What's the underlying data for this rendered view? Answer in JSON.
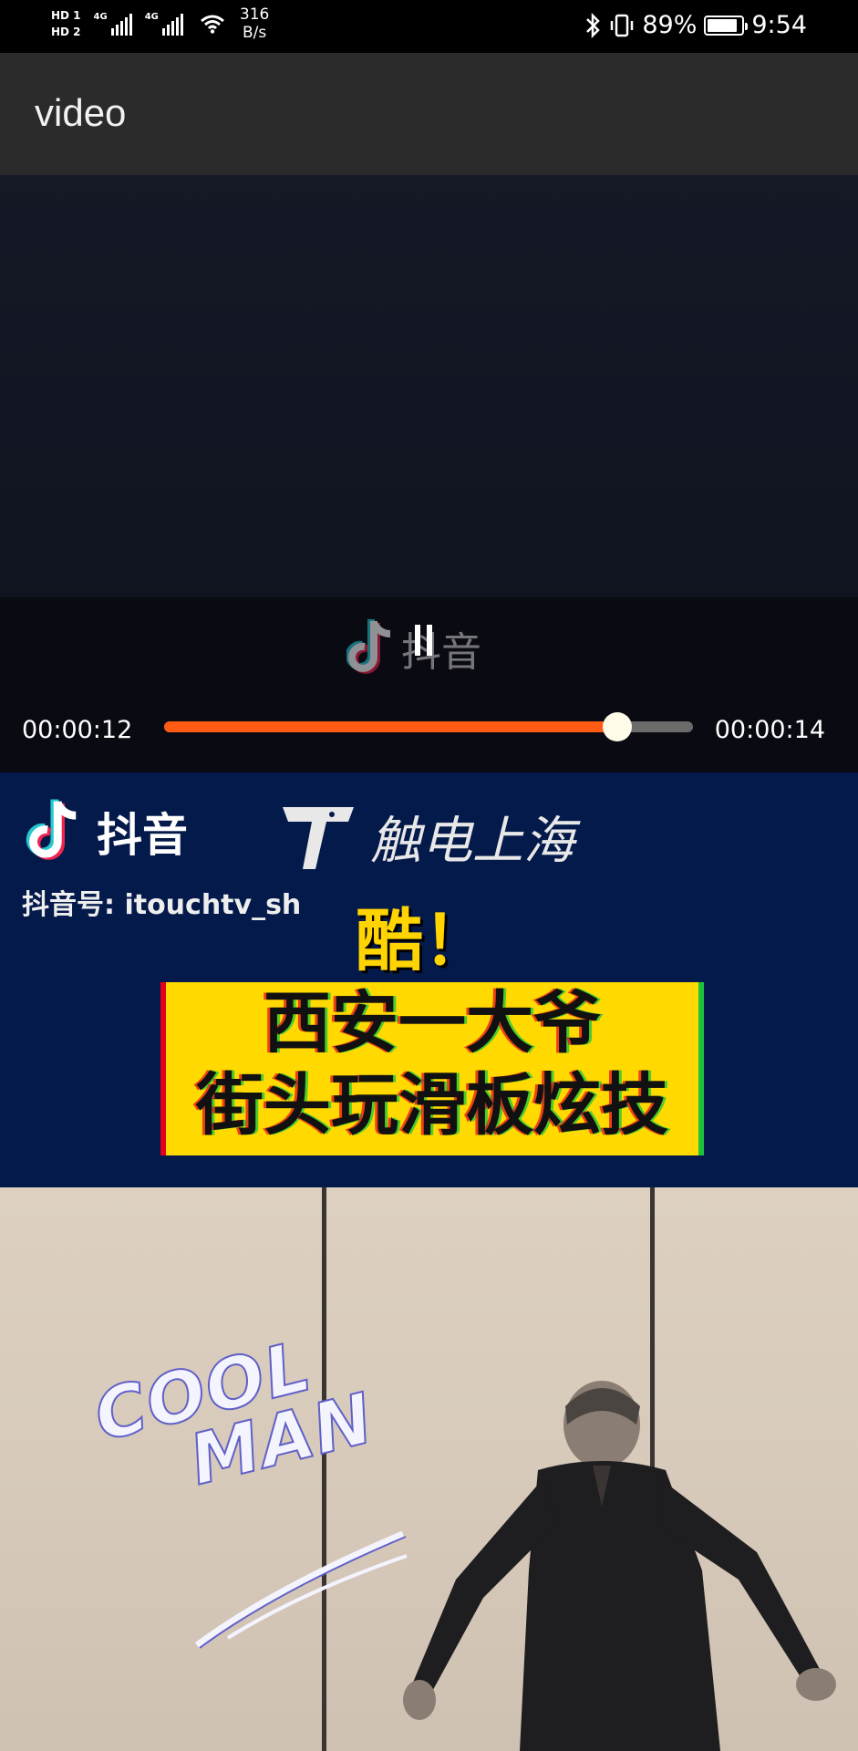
{
  "status_bar": {
    "hd1": "HD 1",
    "hd2": "HD 2",
    "net1": "4G",
    "net2": "4G",
    "speed_value": "316",
    "speed_unit": "B/s",
    "battery": "89%",
    "time": "9:54"
  },
  "app_bar": {
    "title": "video"
  },
  "player": {
    "watermark": "抖音",
    "current_time": "00:00:12",
    "total_time": "00:00:14",
    "progress_fraction": 0.857,
    "accent": "#ff5b14"
  },
  "video_frame": {
    "tiktok_label": "抖音",
    "channel_name": "触电上海",
    "handle": "抖音号: itouchtv_sh",
    "exclaim": "酷！",
    "headline_line1": "西安一大爷",
    "headline_line2": "街头玩滑板炫技",
    "cool": "COOL",
    "man": "MAN"
  }
}
